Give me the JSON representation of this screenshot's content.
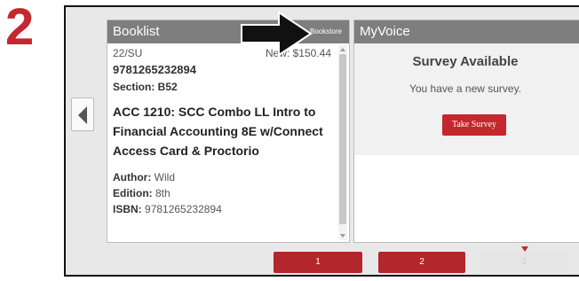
{
  "step_number": "2",
  "booklist": {
    "title": "Booklist",
    "bookstore_link": "Bookstore",
    "term": "22/SU",
    "price": "New: $150.44",
    "isbn_top": "9781265232894",
    "section": "Section: B52",
    "course_title": "ACC 1210: SCC Combo LL Intro to Financial Accounting 8E w/Connect Access Card & Proctorio",
    "author_label": "Author:",
    "author_value": "Wild",
    "edition_label": "Edition:",
    "edition_value": "8th",
    "isbn_label": "ISBN:",
    "isbn_value": "9781265232894"
  },
  "myvoice": {
    "title": "MyVoice",
    "survey_title": "Survey Available",
    "survey_message": "You have a new survey.",
    "take_survey_label": "Take Survey"
  },
  "pager": {
    "pages": [
      "1",
      "2",
      "3"
    ],
    "current_page": "3"
  },
  "icons": {
    "prev": "chevron-left-icon",
    "callout": "arrow-right-icon"
  },
  "colors": {
    "accent": "#c4272d",
    "header": "#7e7e7e",
    "pager_active": "#b3262b",
    "pager_inactive": "#e6e6e6"
  }
}
